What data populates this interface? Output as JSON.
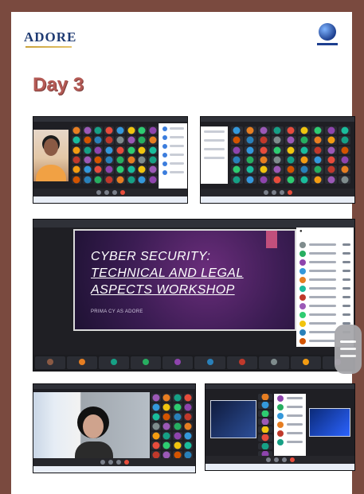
{
  "header": {
    "logo_text": "ADORE",
    "title": "Day 3"
  },
  "slide": {
    "line1": "CYBER SECURITY:",
    "line2": "TECHNICAL AND LEGAL",
    "line3": "ASPECTS WORKSHOP",
    "presenter": "PRIMA CY AS ADORE"
  },
  "icons": {
    "menu_handle": "hamburger-menu-icon",
    "right_logo": "globe-logo-icon"
  },
  "colors": {
    "outer_background": "#7a4a3f",
    "title_color": "#b45a55"
  }
}
